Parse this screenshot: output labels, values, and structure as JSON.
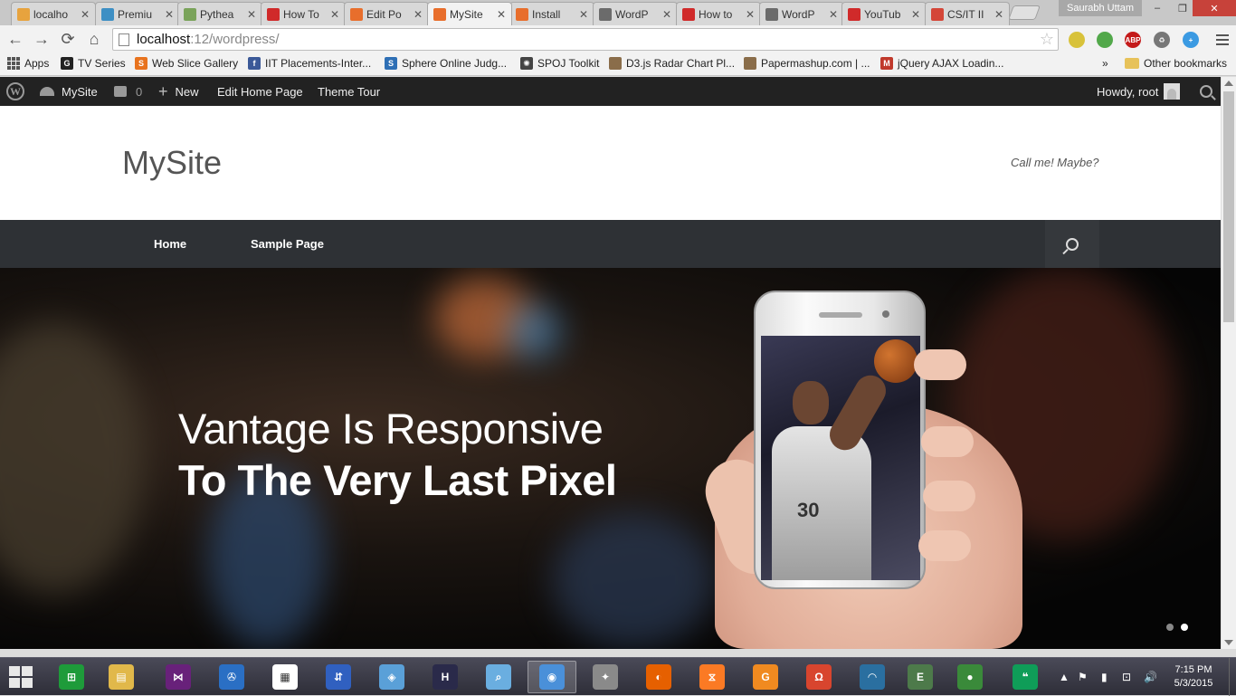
{
  "browser": {
    "tabs": [
      {
        "label": "localho",
        "favicon": "phpmyadmin-icon",
        "color": "#e7a33e"
      },
      {
        "label": "Premiu",
        "favicon": "premium-icon",
        "color": "#3d8fc4"
      },
      {
        "label": "Pythea",
        "favicon": "pythea-icon",
        "color": "#7aa35a"
      },
      {
        "label": "How To",
        "favicon": "youtube-icon",
        "color": "#d02a2a"
      },
      {
        "label": "Edit Po",
        "favicon": "xampp-icon",
        "color": "#e86e2c"
      },
      {
        "label": "MySite",
        "favicon": "xampp-icon",
        "color": "#e86e2c",
        "active": true
      },
      {
        "label": "Install",
        "favicon": "xampp-icon",
        "color": "#e86e2c"
      },
      {
        "label": "WordP",
        "favicon": "wordpress-icon",
        "color": "#6b6b6b"
      },
      {
        "label": "How to",
        "favicon": "youtube-icon",
        "color": "#d02a2a"
      },
      {
        "label": "WordP",
        "favicon": "wordpress-icon",
        "color": "#6b6b6b"
      },
      {
        "label": "YouTub",
        "favicon": "youtube-icon",
        "color": "#d02a2a"
      },
      {
        "label": "CS/IT II",
        "favicon": "gmail-icon",
        "color": "#d44638"
      }
    ],
    "close_glyph": "✕",
    "profile_name": "Saurabh Uttam",
    "window_controls": {
      "minimize": "‒",
      "restore": "❐",
      "close": "✕"
    },
    "address": {
      "host": "localhost",
      "path": ":12/wordpress/"
    },
    "nav": {
      "back": "←",
      "forward": "→",
      "reload": "⟳",
      "home": "⌂"
    },
    "star_glyph": "☆",
    "extensions": [
      {
        "name": "extension-yellow-icon",
        "color": "#d8c23a",
        "glyph": ""
      },
      {
        "name": "evernote-web-icon",
        "color": "#52a84a",
        "glyph": ""
      },
      {
        "name": "adblock-plus-icon",
        "color": "#c41a1a",
        "glyph": "ABP"
      },
      {
        "name": "recycle-icon",
        "color": "#777777",
        "glyph": "♻"
      },
      {
        "name": "plus-extension-icon",
        "color": "#3b9ae2",
        "glyph": "+"
      }
    ],
    "bookmarks": [
      {
        "label": "Apps",
        "icon": "apps-grid-icon"
      },
      {
        "label": "TV Series",
        "icon": "tv-series-icon",
        "color": "#222222",
        "glyph": "G"
      },
      {
        "label": "Web Slice Gallery",
        "icon": "web-slice-icon",
        "color": "#e8731e",
        "glyph": "S"
      },
      {
        "label": "IIT Placements-Inter...",
        "icon": "facebook-icon",
        "color": "#3b5998",
        "glyph": "f"
      },
      {
        "label": "Sphere Online Judg...",
        "icon": "spoj-icon",
        "color": "#2e6fb5",
        "glyph": "S"
      },
      {
        "label": "SPOJ Toolkit",
        "icon": "spoj-toolkit-icon",
        "color": "#444444",
        "glyph": "✺"
      },
      {
        "label": "D3.js Radar Chart Pl...",
        "icon": "d3-icon",
        "color": "#8a6d4a",
        "glyph": ""
      },
      {
        "label": "Papermashup.com | ...",
        "icon": "papermashup-icon",
        "color": "#8a6d4a",
        "glyph": ""
      },
      {
        "label": "jQuery AJAX Loadin...",
        "icon": "jquery-icon",
        "color": "#c0392b",
        "glyph": "M"
      }
    ],
    "bookmarks_overflow": "»",
    "other_bookmarks": "Other bookmarks"
  },
  "wp_adminbar": {
    "site_name": "MySite",
    "comments_count": "0",
    "new_label": "New",
    "new_glyph": "+",
    "edit_label": "Edit Home Page",
    "tour_label": "Theme Tour",
    "howdy": "Howdy, root",
    "wp_logo_glyph": "W"
  },
  "site": {
    "title": "MySite",
    "tagline": "Call me! Maybe?",
    "menu": [
      {
        "label": "Home"
      },
      {
        "label": "Sample Page"
      }
    ],
    "slide": {
      "line1": "Vantage Is Responsive",
      "line2": "To The Very Last Pixel",
      "jersey": "30",
      "active_slide": 2,
      "slide_count": 2
    }
  },
  "taskbar": {
    "apps": [
      {
        "name": "windows-store-icon",
        "color": "#1e9b3a",
        "glyph": "⊞"
      },
      {
        "name": "file-explorer-icon",
        "color": "#e1b84a",
        "glyph": "▤"
      },
      {
        "name": "visual-studio-icon",
        "color": "#68217a",
        "glyph": "⋈"
      },
      {
        "name": "remote-app-icon",
        "color": "#2a6fc4",
        "glyph": "✇"
      },
      {
        "name": "apps-tile-icon",
        "color": "#ffffff",
        "glyph": "▦"
      },
      {
        "name": "network-app-icon",
        "color": "#3060c0",
        "glyph": "⇵"
      },
      {
        "name": "photo-viewer-icon",
        "color": "#5aa0d8",
        "glyph": "◈"
      },
      {
        "name": "h-app-icon",
        "color": "#2a2a4a",
        "glyph": "H"
      },
      {
        "name": "magnifier-app-icon",
        "color": "#6aaee0",
        "glyph": "⌕"
      },
      {
        "name": "chrome-icon",
        "color": "#4a90d9",
        "glyph": "◉",
        "active": true
      },
      {
        "name": "bird-app-icon",
        "color": "#8a8a8a",
        "glyph": "✦"
      },
      {
        "name": "firefox-icon",
        "color": "#e66000",
        "glyph": "◐"
      },
      {
        "name": "xampp-icon",
        "color": "#fb7a24",
        "glyph": "⧖"
      },
      {
        "name": "pdf-app-icon",
        "color": "#f08a20",
        "glyph": "G"
      },
      {
        "name": "headphones-icon",
        "color": "#d8452e",
        "glyph": "Ω"
      },
      {
        "name": "wifi-app-icon",
        "color": "#2a6fa0",
        "glyph": "◠"
      },
      {
        "name": "evernote-icon",
        "color": "#4d7a4a",
        "glyph": "E"
      },
      {
        "name": "globe-icon",
        "color": "#3a8a3a",
        "glyph": "●"
      },
      {
        "name": "hangouts-icon",
        "color": "#0f9d58",
        "glyph": "❝"
      }
    ],
    "tray": {
      "expand": "▲",
      "flag": "⚑",
      "power": "▮",
      "network": "⊡",
      "volume": "🔊"
    },
    "time": "7:15 PM",
    "date": "5/3/2015"
  },
  "colors": {
    "adminbar": "#222222",
    "sitenav": "#2e3135",
    "taskbar": "#38384a"
  }
}
